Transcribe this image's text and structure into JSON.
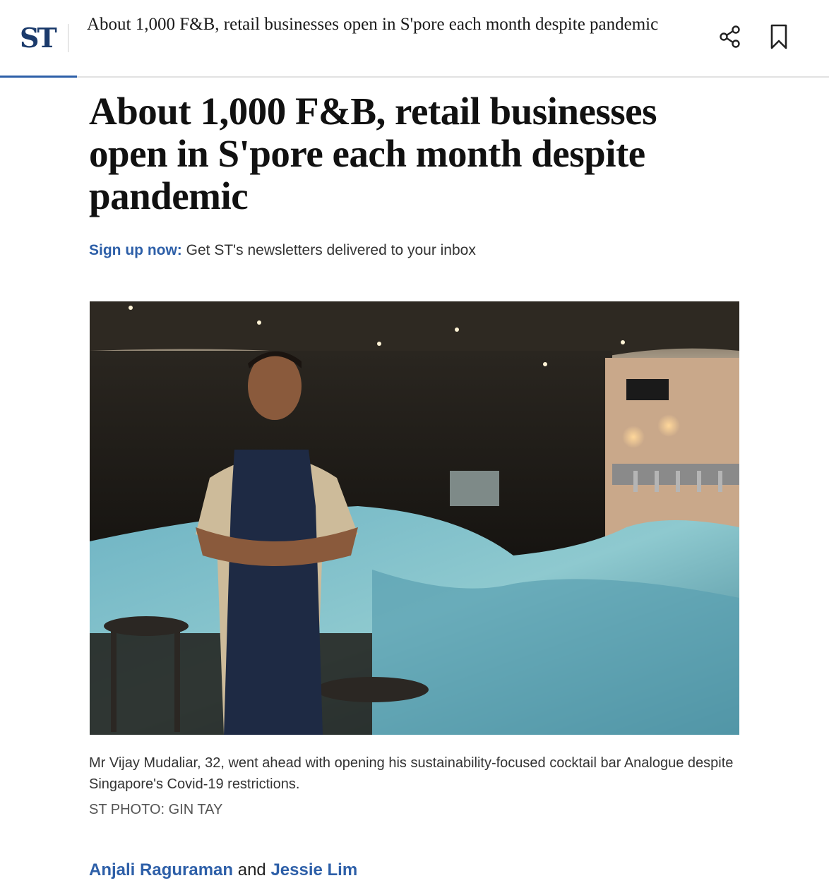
{
  "header": {
    "logo": "ST",
    "title": "About 1,000 F&B, retail businesses open in S'pore each month despite pandemic",
    "reading_progress": 0.093,
    "share_icon": "share-icon",
    "bookmark_icon": "bookmark-icon"
  },
  "article": {
    "headline": "About 1,000 F&B, retail businesses open in S'pore each month despite pandemic",
    "signup": {
      "link_label": "Sign up now:",
      "text": " Get ST's newsletters delivered to your inbox"
    },
    "photo": {
      "caption": "Mr Vijay Mudaliar, 32, went ahead with opening his sustainability-focused cocktail bar Analogue despite Singapore's Covid-19 restrictions.",
      "credit": "ST PHOTO: GIN TAY"
    },
    "byline": {
      "author1": "Anjali Raguraman",
      "conjunction": " and ",
      "author2": "Jessie Lim"
    }
  },
  "colors": {
    "accent": "#2d5fa8",
    "logo": "#1b3a6b"
  }
}
